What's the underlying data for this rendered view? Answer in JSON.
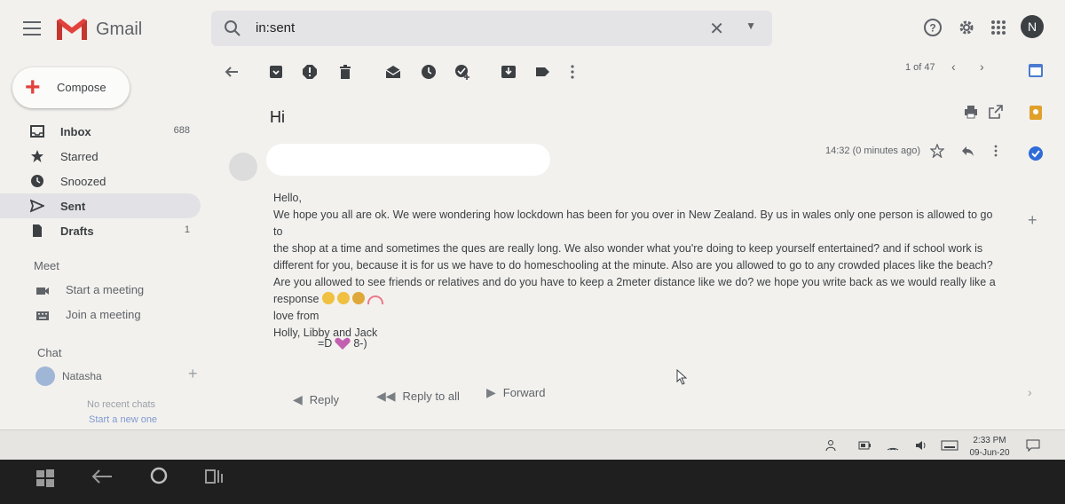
{
  "header": {
    "app_name": "Gmail",
    "search_value": "in:sent",
    "avatar_letter": "N"
  },
  "sidebar": {
    "compose_label": "Compose",
    "items": [
      {
        "label": "Inbox",
        "count": "688",
        "icon": "inbox-icon"
      },
      {
        "label": "Starred",
        "count": "",
        "icon": "star-icon"
      },
      {
        "label": "Snoozed",
        "count": "",
        "icon": "clock-icon"
      },
      {
        "label": "Sent",
        "count": "",
        "icon": "send-icon"
      },
      {
        "label": "Drafts",
        "count": "1",
        "icon": "draft-icon"
      }
    ],
    "meet_title": "Meet",
    "meet_items": [
      "Start a meeting",
      "Join a meeting"
    ],
    "chat_title": "Chat",
    "chat_user": "Natasha",
    "no_recent": "No recent chats",
    "start_new": "Start a new one"
  },
  "toolbar": {
    "pager": "1 of 47"
  },
  "email": {
    "subject": "Hi",
    "time": "14:32 (0 minutes ago)",
    "greeting": "Hello,",
    "body_lines": [
      "We hope you all are ok. We were wondering how lockdown has been for you over in New Zealand. By us in wales only one person is allowed to go to",
      "the shop at a time and sometimes the ques are really long. We also wonder what you're doing to keep yourself entertained? and if school work is",
      "different for you, because it is for us we have to do homeschooling at the minute. Also are you allowed to go to any crowded places like the beach?",
      "Are you allowed to see friends or relatives and do you have to keep a 2meter distance like we do? we hope you write back as we would really like a"
    ],
    "response_word": "response",
    "love_from": "love from",
    "names": "Holly, Libby and Jack",
    "sig_left": "=D",
    "sig_right": "8-)",
    "reply_label": "Reply",
    "reply_all_label": "Reply to all",
    "forward_label": "Forward"
  },
  "taskbar": {
    "time": "2:33 PM",
    "date": "09-Jun-20"
  },
  "colors": {
    "gmail_red": "#e2423d",
    "active_item": "#e2e2e6"
  }
}
